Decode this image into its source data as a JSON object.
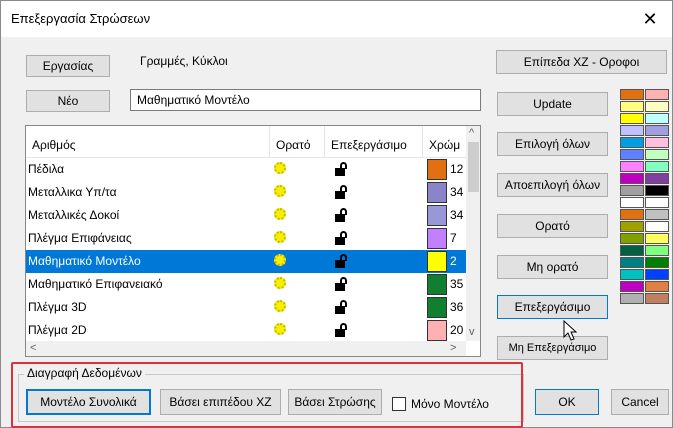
{
  "window": {
    "title": "Επεξεργασία Στρώσεων",
    "close_glyph": "✕"
  },
  "work": {
    "button_label": "Εργασίας",
    "label": "Γραμμές, Κύκλοι"
  },
  "new": {
    "button_label": "Νέο",
    "name_value": "Μαθηματικό Μοντέλο"
  },
  "list": {
    "columns": [
      "Αριθμός",
      "Ορατό",
      "Επεξεργάσιμο",
      "Χρώμ"
    ],
    "rows": [
      {
        "name": "Πέδιλα",
        "color": "#e07010",
        "num": "12"
      },
      {
        "name": "Μεταλλικα Υπ/τα",
        "color": "#8a84c8",
        "num": "34"
      },
      {
        "name": "Μεταλλικές Δοκοί",
        "color": "#9898d8",
        "num": "34"
      },
      {
        "name": "Πλέγμα Επιφάνειας",
        "color": "#c080ff",
        "num": "7"
      },
      {
        "name": "Μαθηματικό Μοντέλο",
        "color": "#ffff00",
        "num": "2",
        "selected": true
      },
      {
        "name": "Μαθηματικό Επιφανειακό",
        "color": "#108030",
        "num": "35"
      },
      {
        "name": "Πλέγμα 3D",
        "color": "#108030",
        "num": "36"
      },
      {
        "name": "Πλέγμα 2D",
        "color": "#ffb0b0",
        "num": "20"
      }
    ]
  },
  "right_buttons": {
    "xz_levels": "Επίπεδα ΧΖ - Οροφοι",
    "update": "Update",
    "select_all": "Επιλογή όλων",
    "deselect_all": "Αποεπιλογή όλων",
    "visible": "Ορατό",
    "not_visible": "Μη ορατό",
    "editable": "Επεξεργάσιμο",
    "not_editable": "Μη Επεξεργάσιμο"
  },
  "palette_colors": [
    "#e07010",
    "#ffb0b0",
    "#ffff80",
    "#ffffc0",
    "#ffff00",
    "#c0ffff",
    "#c0c0ff",
    "#a0a0e0",
    "#00a0e0",
    "#ffc0e0",
    "#6080ff",
    "#c0ffc0",
    "#ff80ff",
    "#80ffc0",
    "#c000c0",
    "#8040a0",
    "#a0a0a0",
    "#000000",
    "#ffffff",
    "#ffffff",
    "#e07010",
    "#c0c0c0",
    "#a0a000",
    "#ffffff",
    "#80a000",
    "#ffff60",
    "#006040",
    "#80ff80",
    "#008080",
    "#008000",
    "#00c0c0",
    "#0040ff",
    "#c000c0",
    "#e08040",
    "#b0b0b0",
    "#c08060"
  ],
  "delete_group": {
    "title": "Διαγραφή Δεδομένων",
    "model_total": "Μοντέλο Συνολικά",
    "by_xz_level": "Βάσει επιπέδου ΧΖ",
    "by_layer": "Βάσει Στρώσης",
    "model_only": "Μόνο Μοντέλο"
  },
  "dialog": {
    "ok": "OK",
    "cancel": "Cancel"
  },
  "scroll": {
    "up": "^",
    "down": "v",
    "left": "<",
    "right": ">"
  }
}
